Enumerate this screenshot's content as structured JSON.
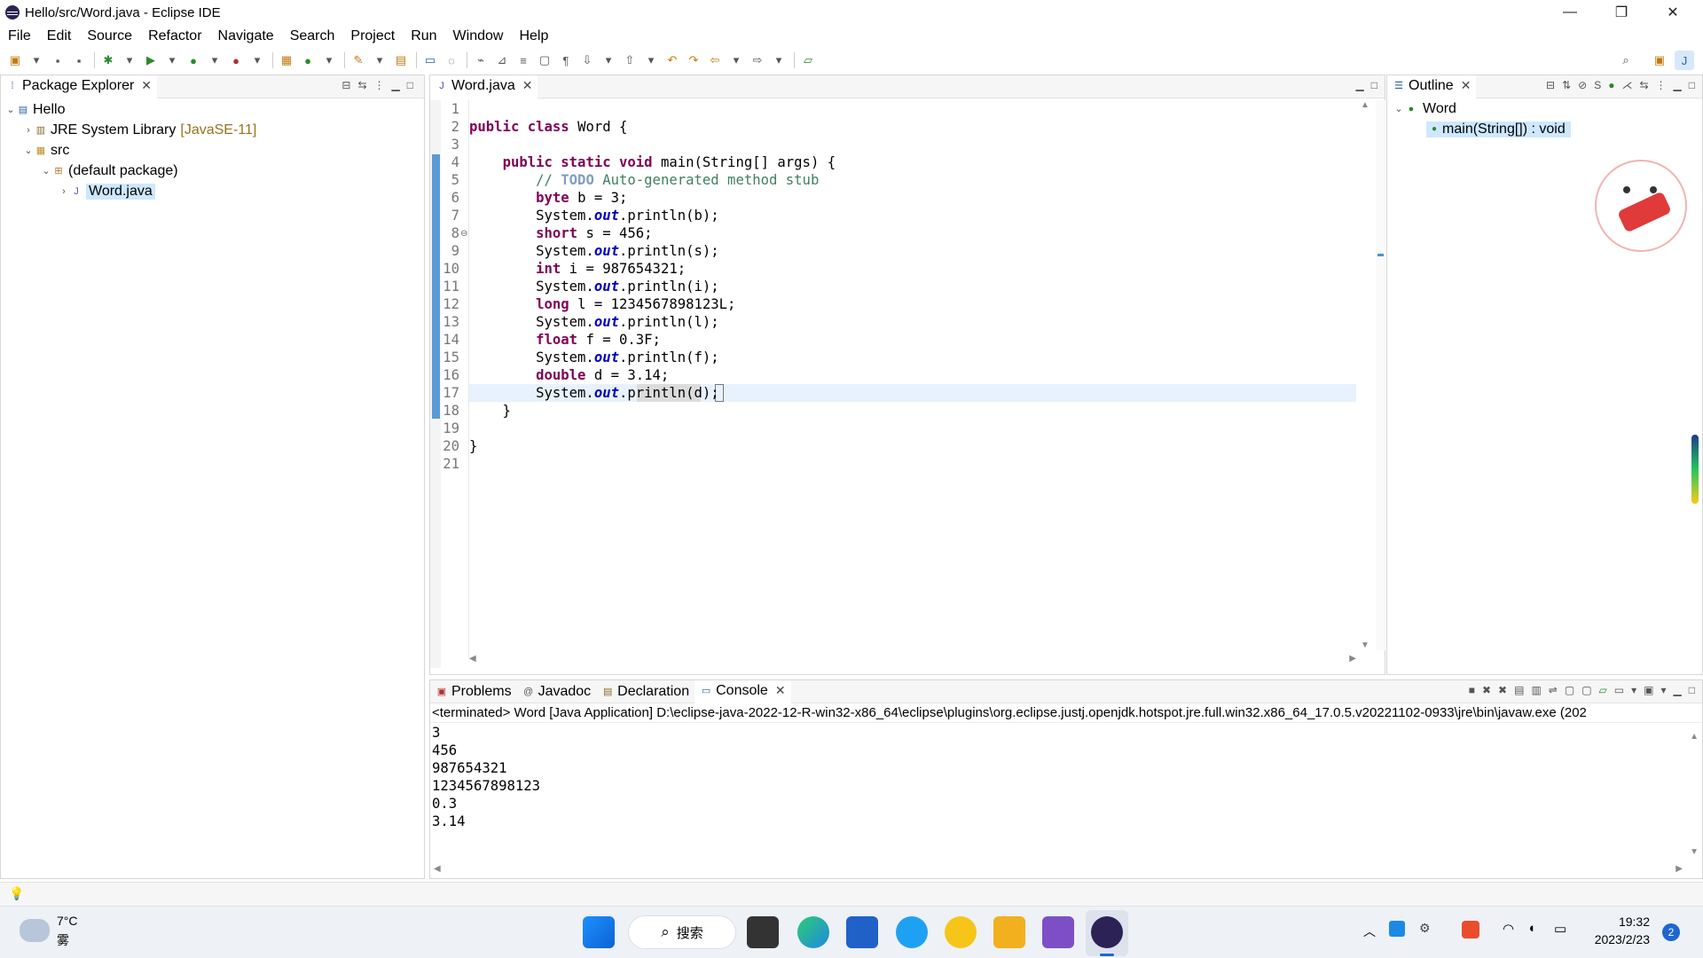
{
  "window": {
    "title": "Hello/src/Word.java - Eclipse IDE",
    "min": "—",
    "max": "❐",
    "close": "✕"
  },
  "menu": [
    "File",
    "Edit",
    "Source",
    "Refactor",
    "Navigate",
    "Search",
    "Project",
    "Run",
    "Window",
    "Help"
  ],
  "package_explorer": {
    "tab_label": "Package Explorer",
    "tree": {
      "project": "Hello",
      "jre": "JRE System Library",
      "jre_version": "[JavaSE-11]",
      "src": "src",
      "package": "(default package)",
      "file": "Word.java"
    }
  },
  "editor": {
    "tab_label": "Word.java",
    "line_numbers": [
      "1",
      "2",
      "3",
      "4",
      "5",
      "6",
      "7",
      "8",
      "9",
      "10",
      "11",
      "12",
      "13",
      "14",
      "15",
      "16",
      "17",
      "18",
      "19",
      "20",
      "21"
    ],
    "lines": [
      [],
      [
        {
          "t": "public ",
          "c": "kw"
        },
        {
          "t": "class ",
          "c": "kw"
        },
        {
          "t": "Word {",
          "c": ""
        }
      ],
      [],
      [
        {
          "t": "    ",
          "c": ""
        },
        {
          "t": "public ",
          "c": "kw"
        },
        {
          "t": "static ",
          "c": "kw"
        },
        {
          "t": "void ",
          "c": "kw"
        },
        {
          "t": "main(String[] args) {",
          "c": ""
        }
      ],
      [
        {
          "t": "        // ",
          "c": "cm"
        },
        {
          "t": "TODO",
          "c": "td"
        },
        {
          "t": " Auto-generated method stub",
          "c": "cm"
        }
      ],
      [
        {
          "t": "        ",
          "c": ""
        },
        {
          "t": "byte ",
          "c": "kw"
        },
        {
          "t": "b = 3;",
          "c": ""
        }
      ],
      [
        {
          "t": "        System.",
          "c": ""
        },
        {
          "t": "out",
          "c": "fld"
        },
        {
          "t": ".println(b);",
          "c": ""
        }
      ],
      [
        {
          "t": "        ",
          "c": ""
        },
        {
          "t": "short ",
          "c": "kw"
        },
        {
          "t": "s = 456;",
          "c": ""
        }
      ],
      [
        {
          "t": "        System.",
          "c": ""
        },
        {
          "t": "out",
          "c": "fld"
        },
        {
          "t": ".println(s);",
          "c": ""
        }
      ],
      [
        {
          "t": "        ",
          "c": ""
        },
        {
          "t": "int ",
          "c": "kw"
        },
        {
          "t": "i = 987654321;",
          "c": ""
        }
      ],
      [
        {
          "t": "        System.",
          "c": ""
        },
        {
          "t": "out",
          "c": "fld"
        },
        {
          "t": ".println(i);",
          "c": ""
        }
      ],
      [
        {
          "t": "        ",
          "c": ""
        },
        {
          "t": "long ",
          "c": "kw"
        },
        {
          "t": "l = 1234567898123L;",
          "c": ""
        }
      ],
      [
        {
          "t": "        System.",
          "c": ""
        },
        {
          "t": "out",
          "c": "fld"
        },
        {
          "t": ".println(l);",
          "c": ""
        }
      ],
      [
        {
          "t": "        ",
          "c": ""
        },
        {
          "t": "float ",
          "c": "kw"
        },
        {
          "t": "f = 0.3F;",
          "c": ""
        }
      ],
      [
        {
          "t": "        System.",
          "c": ""
        },
        {
          "t": "out",
          "c": "fld"
        },
        {
          "t": ".println(f);",
          "c": ""
        }
      ],
      [
        {
          "t": "        ",
          "c": ""
        },
        {
          "t": "double ",
          "c": "kw"
        },
        {
          "t": "d = 3.14;",
          "c": ""
        }
      ],
      [
        {
          "t": "        System.",
          "c": ""
        },
        {
          "t": "out",
          "c": "fld"
        },
        {
          "t": ".println(d);",
          "c": ""
        }
      ],
      [
        {
          "t": "    }",
          "c": ""
        }
      ],
      [],
      [
        {
          "t": "}",
          "c": ""
        }
      ],
      []
    ]
  },
  "outline": {
    "tab_label": "Outline",
    "class_name": "Word",
    "method": "main(String[]) : void"
  },
  "bottom": {
    "tabs": [
      "Problems",
      "Javadoc",
      "Declaration",
      "Console"
    ],
    "console_header": "<terminated> Word [Java Application] D:\\eclipse-java-2022-12-R-win32-x86_64\\eclipse\\plugins\\org.eclipse.justj.openjdk.hotspot.jre.full.win32.x86_64_17.0.5.v20221102-0933\\jre\\bin\\javaw.exe  (202",
    "output": [
      "3",
      "456",
      "987654321",
      "1234567898123",
      "0.3",
      "3.14"
    ]
  },
  "taskbar": {
    "weather_temp": "7°C",
    "weather_desc": "雾",
    "search_label": "搜索",
    "time": "19:32",
    "date": "2023/2/23",
    "notification_count": "2"
  }
}
